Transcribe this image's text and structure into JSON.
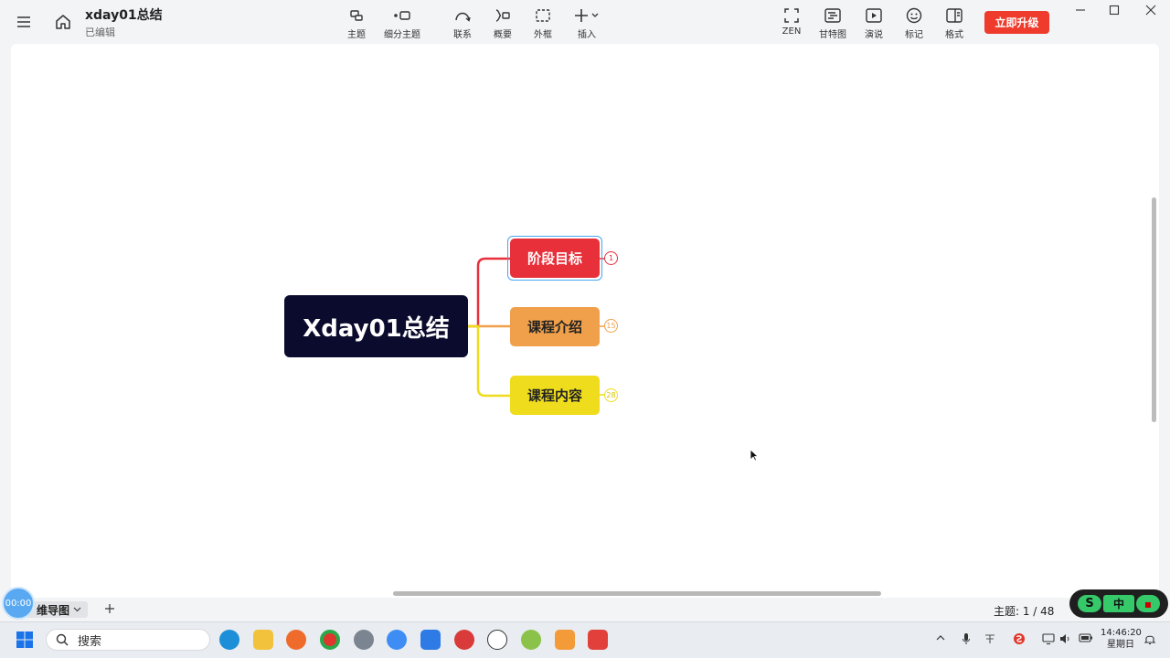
{
  "app": {
    "doc_title": "xday01总结",
    "doc_status": "已编辑",
    "upgrade_label": "立即升级"
  },
  "toolbar": {
    "left": [
      {
        "id": "topic",
        "label": "主题",
        "icon": "topic-icon"
      },
      {
        "id": "subtopic",
        "label": "细分主题",
        "icon": "subtopic-icon"
      },
      {
        "id": "relation",
        "label": "联系",
        "icon": "relation-icon"
      },
      {
        "id": "summary",
        "label": "概要",
        "icon": "summary-icon"
      },
      {
        "id": "boundary",
        "label": "外框",
        "icon": "boundary-icon"
      },
      {
        "id": "insert",
        "label": "插入",
        "icon": "insert-icon"
      }
    ],
    "right": [
      {
        "id": "zen",
        "label": "ZEN",
        "icon": "zen-icon"
      },
      {
        "id": "gantt",
        "label": "甘特图",
        "icon": "gantt-icon"
      },
      {
        "id": "present",
        "label": "演说",
        "icon": "present-icon"
      },
      {
        "id": "marker",
        "label": "标记",
        "icon": "smiley-icon"
      },
      {
        "id": "format",
        "label": "格式",
        "icon": "format-icon"
      }
    ]
  },
  "mindmap": {
    "root": "Xday01总结",
    "branches": [
      {
        "label": "阶段目标",
        "count": "1",
        "color": "#e8303b"
      },
      {
        "label": "课程介绍",
        "count": "15",
        "color": "#f0a04b"
      },
      {
        "label": "课程内容",
        "count": "28",
        "color": "#eedc1d"
      }
    ]
  },
  "statusbar": {
    "timer": "00:00",
    "sheet_tab": "维导图",
    "topic_count": "主题: 1 / 48"
  },
  "ime": {
    "s": "S",
    "mode": "中",
    "r": "▪"
  },
  "taskbar": {
    "search_placeholder": "搜索",
    "time": "14:46:20",
    "day": "星期日"
  }
}
